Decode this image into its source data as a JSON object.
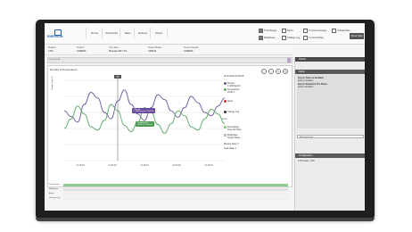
{
  "app": {
    "logo_text": "EMERSON"
  },
  "nav": {
    "items": [
      "Home",
      "Add Paths",
      "Save",
      "Options",
      "About"
    ]
  },
  "options": [
    {
      "label": "Time Range",
      "checked": true
    },
    {
      "label": "Alerts",
      "checked": false
    },
    {
      "label": "3 minute Average",
      "checked": false
    },
    {
      "label": "Unload Data",
      "checked": false
    },
    {
      "label": "Multiphase",
      "checked": true
    },
    {
      "label": "Change Log",
      "checked": false
    },
    {
      "label": "1 second Data",
      "checked": false
    }
  ],
  "action_button": "Show Data",
  "info": {
    "fields": [
      {
        "label": "Model #",
        "value": "1700"
      },
      {
        "label": "Serial #",
        "value": "10488231"
      },
      {
        "label": "Time Zone",
        "value": "Mountain 2017 T E"
      },
      {
        "label": "Sensor Model",
        "value": "CMF100"
      },
      {
        "label": "Sensor Serial #",
        "value": "10488231"
      }
    ]
  },
  "timeline": {
    "label": "10 Jan 2019"
  },
  "chart": {
    "title": "Density & Temperature",
    "icons": [
      "zoom-in-icon",
      "zoom-out-icon",
      "refresh-icon",
      "settings-icon"
    ],
    "y_left_label": "Density (kg/m3)",
    "y_right_label": "Temp",
    "time_ticks": [
      "11:15:00",
      "11:30:00",
      "11:45:00",
      "12:00:00",
      "12:15:00"
    ],
    "cursor_label": "01",
    "tooltip_purple": [
      "Density",
      "1.0000 kg/m3 12:08:45"
    ],
    "tooltip_green": [
      "Temperature",
      "25.00 C 12:08:45"
    ],
    "legend": {
      "date": "25 Jul 2019 12:08:45",
      "density_label": "Density",
      "density_value": "1.0000 kg/m3",
      "temp_label": "Temperature",
      "temp_value": "25.00 C",
      "alerts": "Alerts",
      "change_log": "Change Log",
      "flow_range": "Flow Range",
      "flow_range_sub": "Flow has Data",
      "multiphase": "Multiphase",
      "multiphase_sub": "Single Phase",
      "missing_data": "Missing Data: 0",
      "fault_data": "Fault Data: 0"
    },
    "series_colors": {
      "density": "#6e5a9c",
      "temperature": "#5fa86a"
    }
  },
  "chart_data": {
    "type": "line",
    "series": [
      {
        "name": "Density",
        "values": [
          62,
          55,
          48,
          70,
          85,
          78,
          60,
          52,
          74,
          88,
          70,
          58,
          50,
          66,
          82,
          76,
          62,
          54,
          66,
          80,
          72,
          60,
          56,
          68,
          78
        ]
      },
      {
        "name": "Temperature",
        "values": [
          40,
          52,
          68,
          58,
          42,
          38,
          50,
          70,
          62,
          44,
          36,
          48,
          66,
          60,
          45,
          34,
          46,
          62,
          56,
          42,
          38,
          52,
          64,
          58,
          46
        ]
      }
    ],
    "x": [
      "11:15:00",
      "11:30:00",
      "11:45:00",
      "12:00:00",
      "12:15:00"
    ]
  },
  "bands": [
    {
      "label": "Flow Range",
      "color": "#8fcf92"
    },
    {
      "label": "Multiphase",
      "color": "#e2e2e2"
    },
    {
      "label": "Alerts",
      "color": "#f0f0f0"
    },
    {
      "label": "Change Log",
      "color": "#f0f0f0"
    }
  ],
  "right_panel": {
    "header": "Details",
    "alerts_header": "Alerts",
    "alert_lines": [
      "Sensor Fault on Ink Meter",
      "Active Condition",
      "Sensor Shutdown The Phase",
      "Active Condition"
    ],
    "change_log": "Enhanced Data",
    "config_header": "Configuration",
    "config_value": "1700 Scale: 1700"
  }
}
